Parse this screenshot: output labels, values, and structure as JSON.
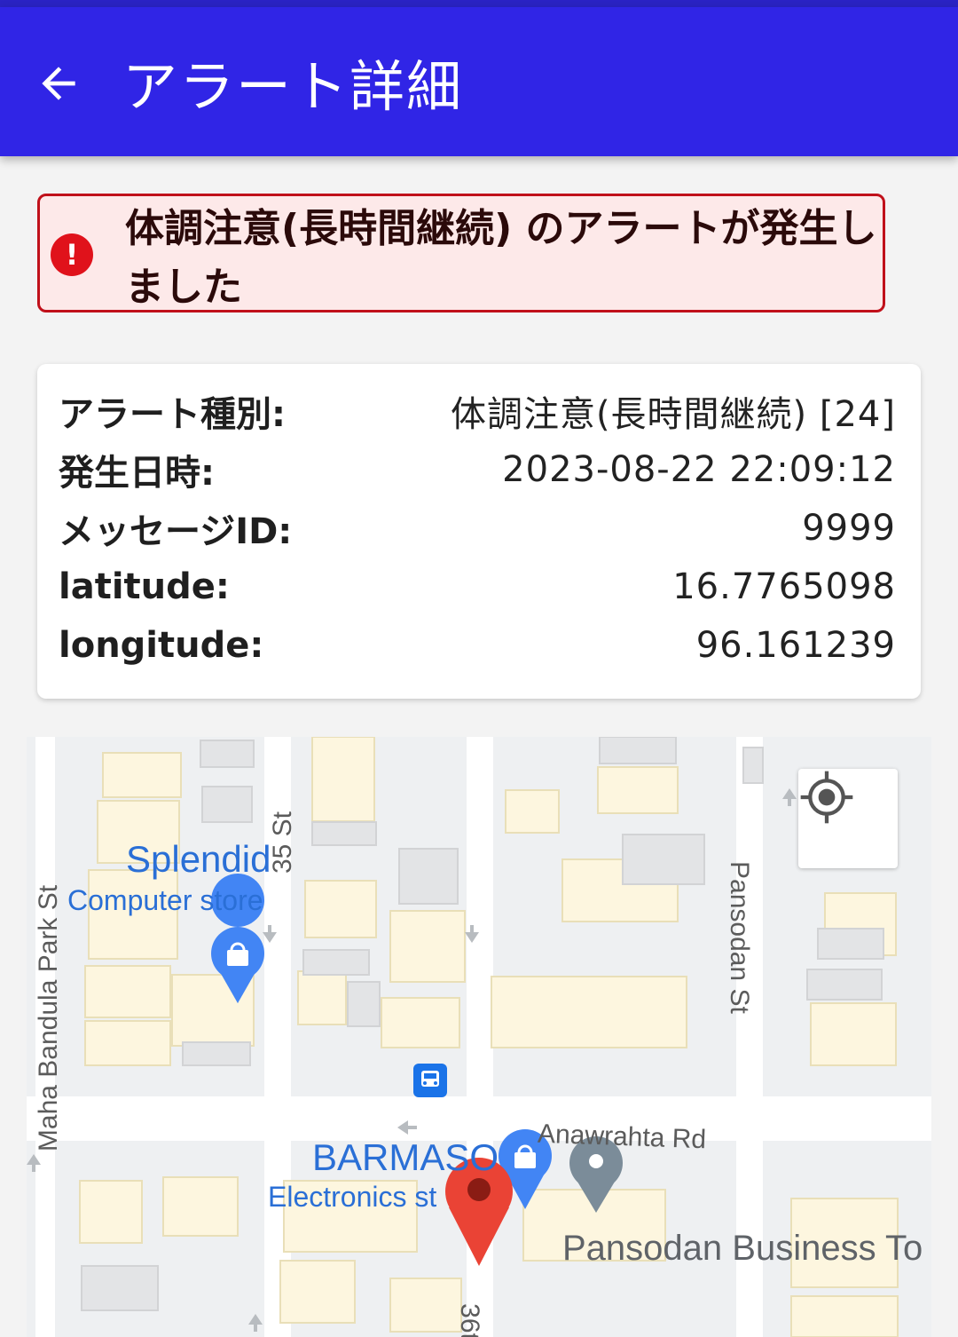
{
  "appbar": {
    "title": "アラート詳細",
    "back_icon": "arrow-left-icon",
    "background": "#3025e6"
  },
  "alert": {
    "message": "体調注意(長時間継続) のアラートが発生しました",
    "icon": "exclamation-circle-icon",
    "accent": "#c0101a",
    "background": "#fde9e9"
  },
  "details": [
    {
      "label": "アラート種別:",
      "value": "体調注意(長時間継続) [24]"
    },
    {
      "label": "発生日時:",
      "value": "2023-08-22 22:09:12"
    },
    {
      "label": "メッセージID:",
      "value": "9999"
    },
    {
      "label": "latitude:",
      "value": "16.7765098"
    },
    {
      "label": "longitude:",
      "value": "96.161239"
    }
  ],
  "map": {
    "locate_icon": "my-location-icon",
    "streets": [
      "Maha Bandula Park St",
      "35 St",
      "Pansodan St",
      "Anawrahta Rd",
      "36t"
    ],
    "pois": [
      {
        "name": "Splendid",
        "category": "Computer store"
      },
      {
        "name": "BARMASO",
        "category": "Electronics st"
      },
      {
        "name": "Pansodan Business To"
      }
    ],
    "marker_color": "#ea4335"
  }
}
